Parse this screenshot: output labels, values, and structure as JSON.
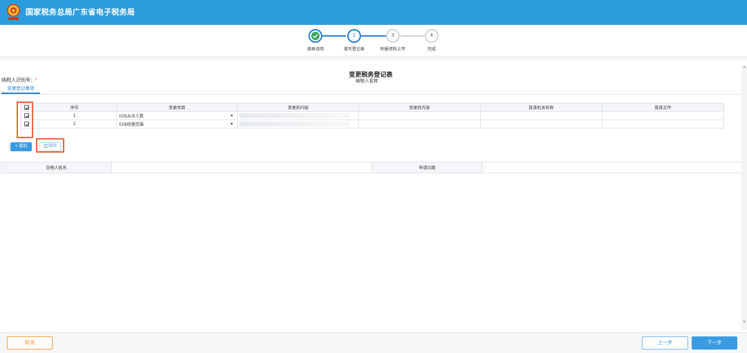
{
  "header": {
    "title": "国家税务总局广东省电子税务局",
    "background_color": "#2b9ddd"
  },
  "steps": [
    {
      "number": "1",
      "label": "填表说明",
      "status": "done"
    },
    {
      "number": "2",
      "label": "填写登记表",
      "status": "active"
    },
    {
      "number": "3",
      "label": "附报资料上传",
      "status": "pending"
    },
    {
      "number": "4",
      "label": "完成",
      "status": "pending"
    }
  ],
  "form": {
    "title": "变更税务登记表",
    "taxpayer_id_label": "纳税人识别号：",
    "taxpayer_id_required": "*",
    "taxpayer_name_label": "纳税人名称",
    "tab_label": "变更登记事项"
  },
  "changes_table": {
    "headers": [
      "序号",
      "变更项目",
      "变更前内容",
      "变更后内容",
      "批准机关名称",
      "批准文件"
    ],
    "rows": [
      {
        "index": "1",
        "item": "020|从业人数",
        "checked": true
      },
      {
        "index": "2",
        "item": "029|经营范围",
        "checked": true
      }
    ],
    "select_all_checked": true
  },
  "actions": {
    "add_label": "+ 增加",
    "delete_label": "删除",
    "delete_icon": "trash-icon"
  },
  "applicant": {
    "name_label": "办税人姓名",
    "date_label": "申请日期",
    "date_value": ":"
  },
  "footer": {
    "cancel_label": "取消",
    "prev_label": "上一步",
    "next_label": "下一步"
  },
  "colors": {
    "accent": "#2b7fc7",
    "primary_button": "#3a9be2",
    "cancel": "#e8922a",
    "highlight": "#e8663a",
    "step_done": "#3aa55a"
  }
}
